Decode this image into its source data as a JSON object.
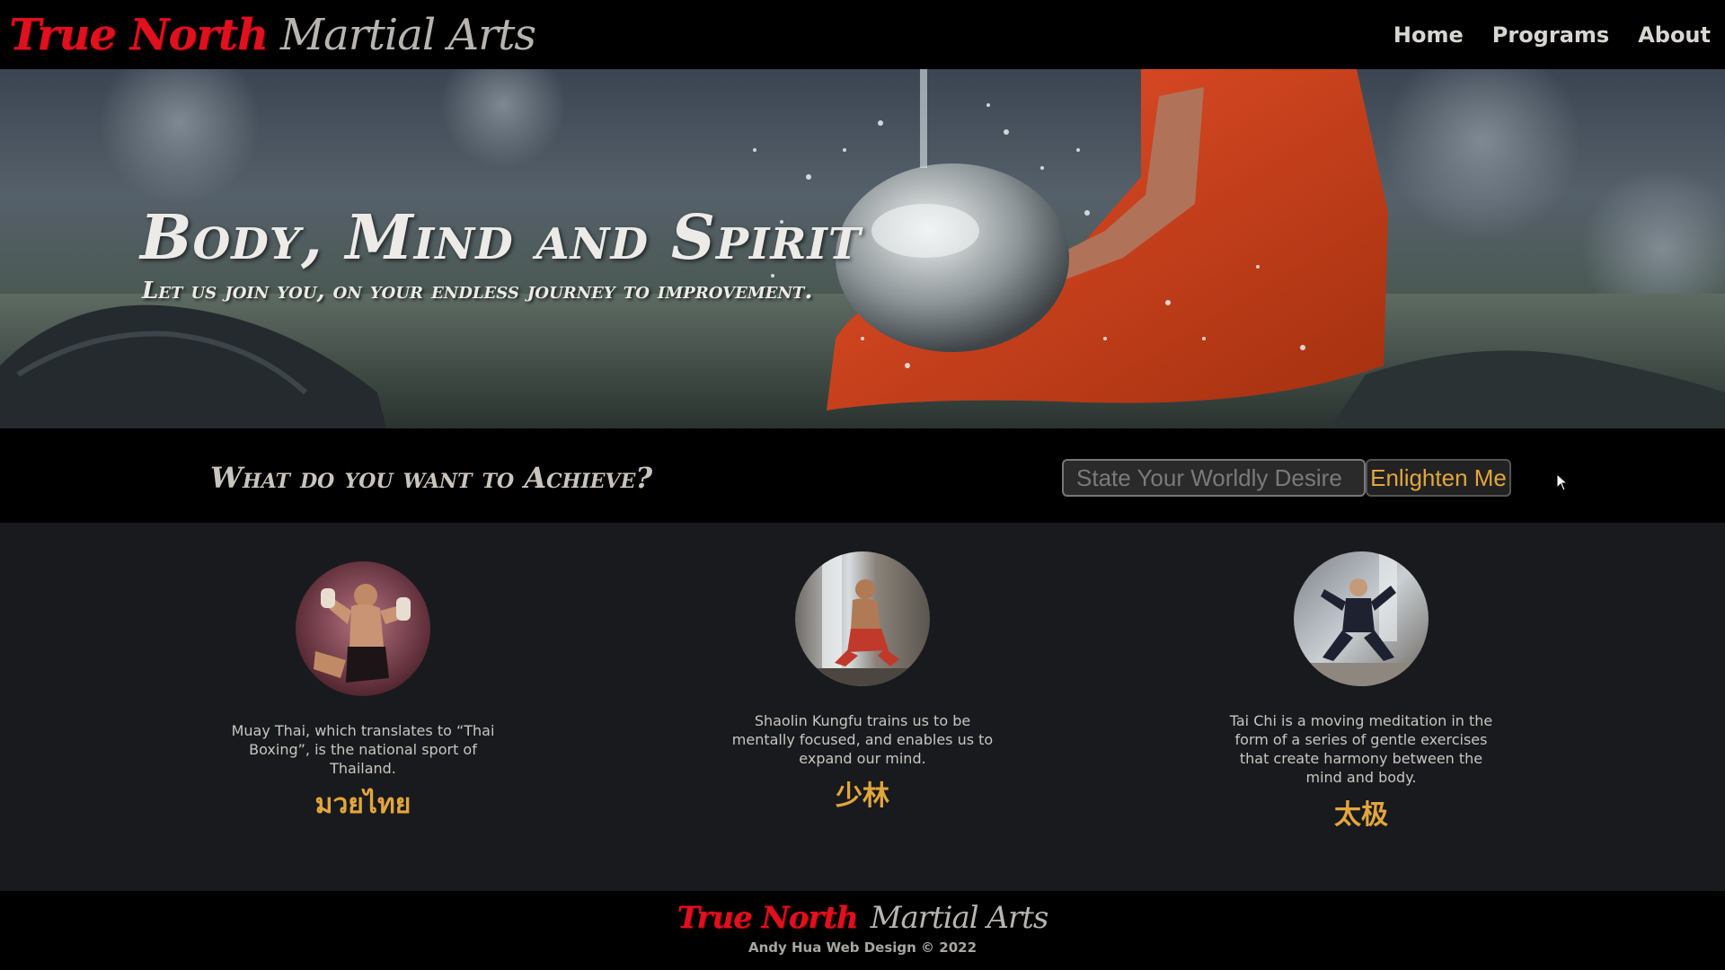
{
  "header": {
    "logo_red": "True North",
    "logo_grey": "Martial Arts",
    "nav": [
      "Home",
      "Programs",
      "About"
    ]
  },
  "hero": {
    "title": "Body, Mind and Spirit",
    "subtitle": "Let us join you, on your endless journey to improvement."
  },
  "achieve": {
    "question": "What do you want to Achieve?",
    "input_placeholder": "State Your Worldly Desire",
    "input_value": "",
    "button_label": "Enlighten Me"
  },
  "programs": [
    {
      "description": "Muay Thai, which translates to “Thai Boxing”, is the national sport of Thailand.",
      "native": "มวยไทย"
    },
    {
      "description": "Shaolin Kungfu trains us to be mentally focused, and enables us to expand our mind.",
      "native": "少林"
    },
    {
      "description": "Tai Chi is a moving meditation in the form of a series of gentle exercises that create harmony between the mind and body.",
      "native": "太极"
    }
  ],
  "footer": {
    "logo_red": "True North",
    "logo_grey": "Martial Arts",
    "credit": "Andy Hua Web Design © 2022"
  },
  "colors": {
    "accent": "#e2a63c",
    "brand_red": "#e0101e",
    "robe": "#d4451e"
  }
}
